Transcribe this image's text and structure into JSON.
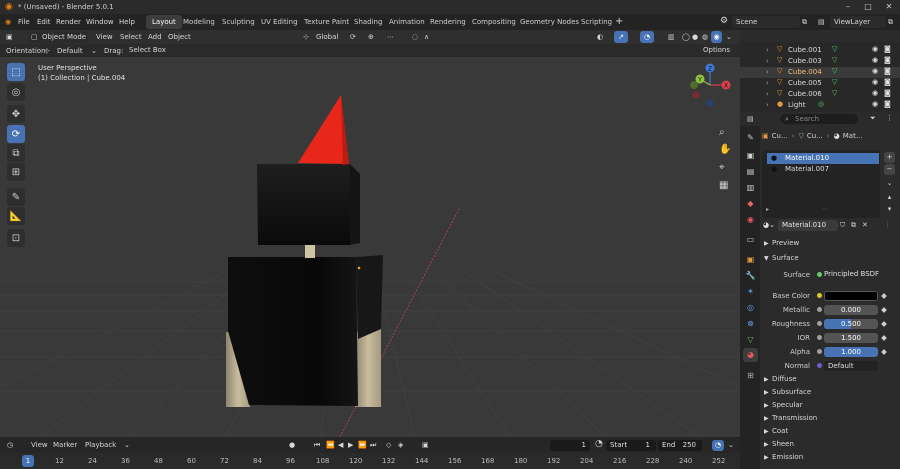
{
  "window": {
    "title": "* (Unsaved) - Blender 5.0.1",
    "scene": "Scene",
    "view_layer": "ViewLayer"
  },
  "menu": {
    "items": [
      "File",
      "Edit",
      "Render",
      "Window",
      "Help"
    ],
    "workspaces": [
      "Layout",
      "Modeling",
      "Sculpting",
      "UV Editing",
      "Texture Paint",
      "Shading",
      "Animation",
      "Rendering",
      "Compositing",
      "Geometry Nodes",
      "Scripting"
    ],
    "active_workspace": "Layout",
    "add_workspace": "+"
  },
  "viewport_header": {
    "mode": "Object Mode",
    "menus": [
      "View",
      "Select",
      "Add",
      "Object"
    ],
    "transform_orientation": "Global",
    "options_label": "Options"
  },
  "tool_options": {
    "orientation_label": "Orientation:",
    "orientation_value": "Default",
    "drag_label": "Drag:",
    "drag_value": "Select Box"
  },
  "viewport": {
    "view_name": "User Perspective",
    "collection_info": "(1) Collection | Cube.004",
    "gizmo_axes": [
      "X",
      "Y",
      "Z"
    ]
  },
  "timeline": {
    "menus": [
      "View",
      "Marker",
      "Playback"
    ],
    "current_frame": "1",
    "start_label": "Start",
    "start_value": "1",
    "end_label": "End",
    "end_value": "250",
    "ticks": [
      "1",
      "12",
      "24",
      "36",
      "48",
      "60",
      "72",
      "84",
      "96",
      "108",
      "120",
      "132",
      "144",
      "156",
      "168",
      "180",
      "192",
      "204",
      "216",
      "228",
      "240",
      "252"
    ]
  },
  "outliner": {
    "items": [
      {
        "name": "Cube.001",
        "type": "mesh"
      },
      {
        "name": "Cube.003",
        "type": "mesh"
      },
      {
        "name": "Cube.004",
        "type": "mesh"
      },
      {
        "name": "Cube.005",
        "type": "mesh"
      },
      {
        "name": "Cube.006",
        "type": "mesh"
      },
      {
        "name": "Light",
        "type": "light"
      }
    ],
    "selected_index": 2
  },
  "properties": {
    "search_placeholder": "Search",
    "breadcrumb": [
      "Cu...",
      "Cu...",
      "Mat..."
    ],
    "material_slots": [
      "Material.010",
      "Material.007"
    ],
    "selected_slot": 0,
    "active_material": "Material.010",
    "panels": {
      "preview": "Preview",
      "surface": "Surface"
    },
    "surface": {
      "surface_label": "Surface",
      "surface_value": "Principled BSDF",
      "base_color_label": "Base Color",
      "base_color_hex": "#000000",
      "metallic_label": "Metallic",
      "metallic_value": "0.000",
      "roughness_label": "Roughness",
      "roughness_value": "0.500",
      "roughness_fraction": 0.5,
      "ior_label": "IOR",
      "ior_value": "1.500",
      "alpha_label": "Alpha",
      "alpha_value": "1.000",
      "alpha_fraction": 1.0,
      "normal_label": "Normal",
      "normal_value": "Default"
    },
    "subpanels": [
      "Diffuse",
      "Subsurface",
      "Specular",
      "Transmission",
      "Coat",
      "Sheen",
      "Emission"
    ]
  },
  "colors": {
    "accent": "#4772b3",
    "cone": "#e8261a",
    "mesh_icon": "#66c96a",
    "x_axis": "#d9404c",
    "y_axis": "#8bc43f",
    "z_axis": "#3d79d6"
  }
}
